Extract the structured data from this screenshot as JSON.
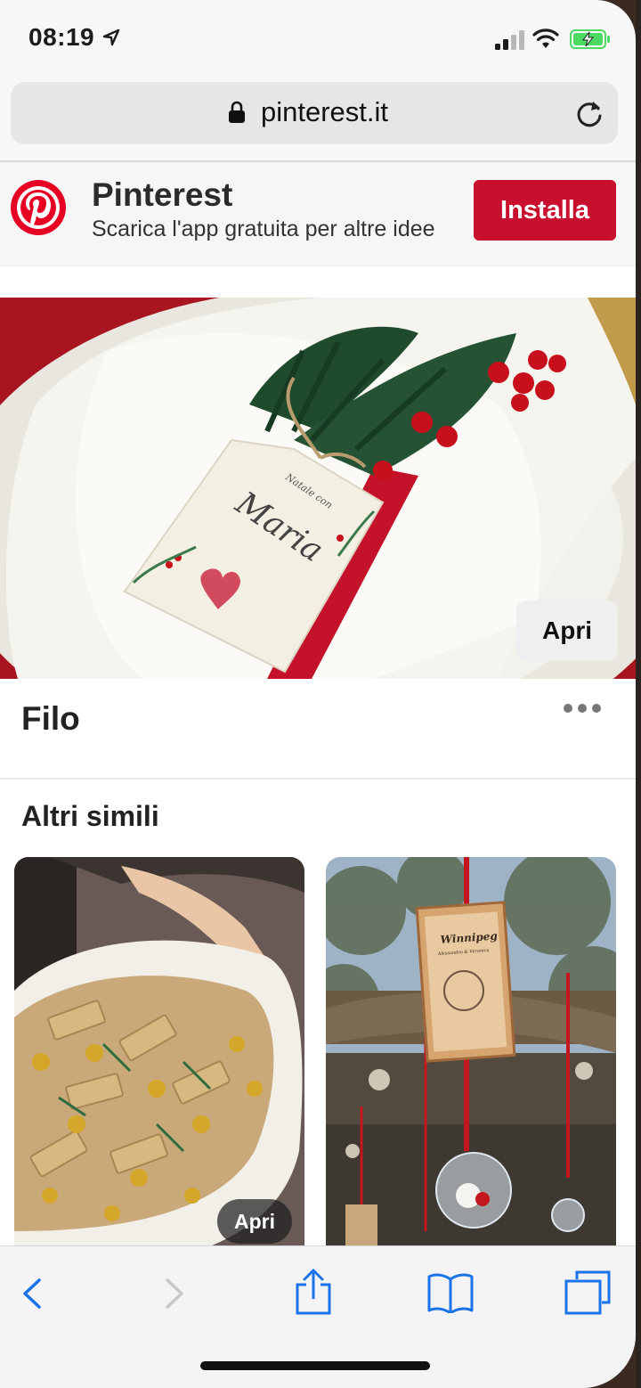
{
  "status": {
    "time": "08:19"
  },
  "browser": {
    "url": "pinterest.it"
  },
  "banner": {
    "title": "Pinterest",
    "subtitle": "Scarica l'app gratuita per altre idee",
    "install_label": "Installa"
  },
  "hero": {
    "open_label": "Apri",
    "tag_name": "Maria",
    "tag_header": "Natale con"
  },
  "pin": {
    "title": "Filo"
  },
  "more": {
    "heading": "Altri simili",
    "cards": [
      {
        "open_label": "Apri"
      },
      {
        "card_text_title": "Winnipeg",
        "card_text_sub": "Alessandro & Veronica"
      }
    ]
  },
  "colors": {
    "brand_red": "#c8102e",
    "link_blue": "#1a73e8"
  }
}
